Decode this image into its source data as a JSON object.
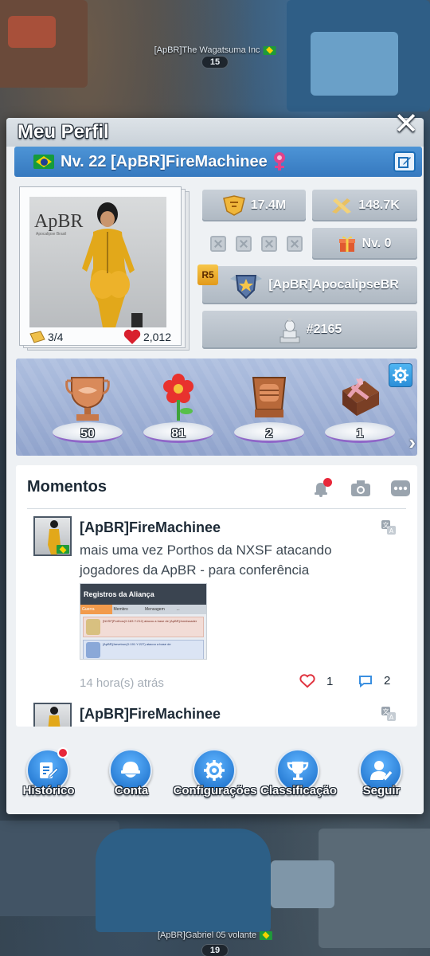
{
  "scene": {
    "top_player": {
      "name": "[ApBR]The Wagatsuma Inc",
      "level": "15"
    },
    "bottom_player": {
      "name": "[ApBR]Gabriel 05 volante",
      "level": "19"
    }
  },
  "panel": {
    "title": "Meu Perfil",
    "close_icon": "close-icon"
  },
  "profile": {
    "level_name": "Nv. 22 [ApBR]FireMachinee",
    "flag": "brazil-flag",
    "gender_icon": "female-icon",
    "portrait_brand": "ApBR",
    "portrait_brand_sub": "Apocalipse Brasil",
    "skins": "3/4",
    "likes": "2,012"
  },
  "stats": {
    "power": "17.4M",
    "kills": "148.7K",
    "gift_level": "Nv. 0",
    "alliance_rank": "R5",
    "alliance_name": "[ApBR]ApocalipseBR",
    "server_rank": "#2165"
  },
  "trophies": [
    {
      "name": "handshake-trophy",
      "count": "50"
    },
    {
      "name": "flower-trophy",
      "count": "81"
    },
    {
      "name": "fist-trophy",
      "count": "2"
    },
    {
      "name": "gift-box-trophy",
      "count": "1"
    }
  ],
  "moments": {
    "title": "Momentos",
    "posts": [
      {
        "author": "[ApBR]FireMachinee",
        "text": "mais uma vez Porthos da NXSF atacando jogadores da ApBR - para conferência",
        "thumb_title": "Registros da Aliança",
        "thumb_tabs": [
          "Guerra",
          "Membro",
          "Mensagem",
          "..."
        ],
        "thumb_line1": "[NXSF]Porthos(X:183 Y:212) atacou a base de [ApBR]Jonnissader",
        "thumb_line2": "[ApBR]Jarvetron(X:191 Y:227) atacou a base de",
        "time": "14 hora(s) atrás",
        "likes": "1",
        "comments": "2"
      },
      {
        "author": "[ApBR]FireMachinee"
      }
    ]
  },
  "nav": [
    {
      "label": "Histórico",
      "icon": "history-edit-icon",
      "badge": true
    },
    {
      "label": "Conta",
      "icon": "account-helmet-icon",
      "badge": false
    },
    {
      "label": "Configurações",
      "icon": "settings-gear-icon",
      "badge": false
    },
    {
      "label": "Classificação",
      "icon": "ranking-trophy-icon",
      "badge": false
    },
    {
      "label": "Seguir",
      "icon": "follow-user-icon",
      "badge": false
    }
  ],
  "colors": {
    "name_bar": "#3f86c9",
    "nav_button": "#2b7fd6",
    "notification_dot": "#e8283a",
    "like_heart": "#e0323e",
    "comment": "#3a8fe0"
  }
}
